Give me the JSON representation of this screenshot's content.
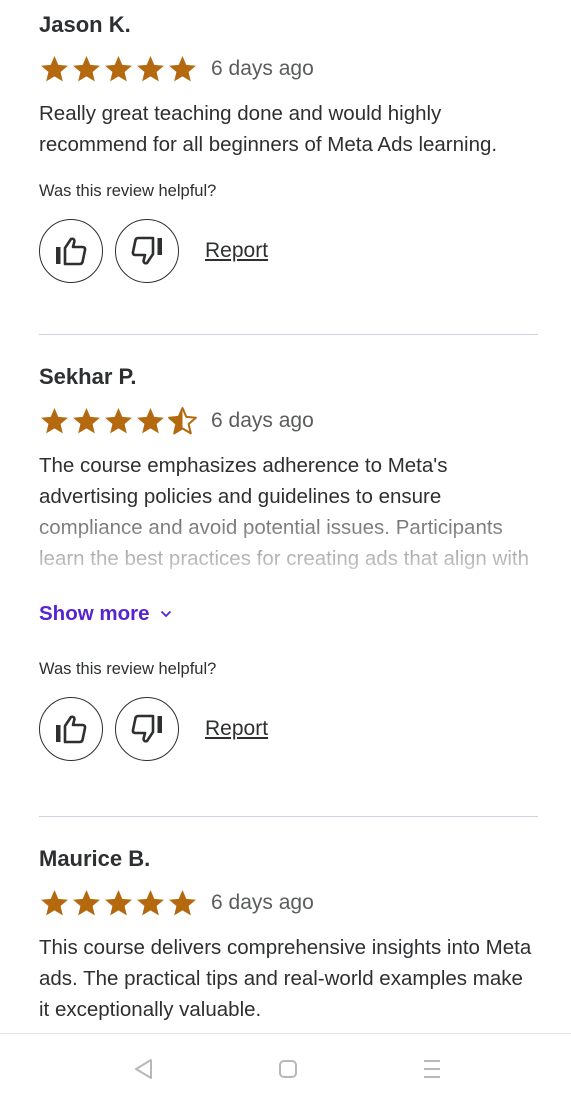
{
  "colors": {
    "star": "#b4690e",
    "link_purple": "#5624d0",
    "text": "#2d2f31",
    "divider": "#d1d2e0"
  },
  "reviews": [
    {
      "name": "Jason K.",
      "rating": 5,
      "date": "6 days ago",
      "text": "Really great teaching done and would highly recommend for all beginners of Meta Ads learning.",
      "helpful_prompt": "Was this review helpful?",
      "report_label": "Report"
    },
    {
      "name": "Sekhar P.",
      "rating": 4.5,
      "date": "6 days ago",
      "text": "The course emphasizes adherence to Meta's advertising policies and guidelines to ensure compliance and avoid potential issues. Participants learn the best practices for creating ads that align with platform requirements and",
      "show_more_label": "Show more",
      "helpful_prompt": "Was this review helpful?",
      "report_label": "Report"
    },
    {
      "name": "Maurice B.",
      "rating": 5,
      "date": "6 days ago",
      "text": "This course delivers comprehensive insights into Meta ads. The practical tips and real-world examples make it exceptionally valuable."
    }
  ],
  "icons": {
    "thumbs_up": "thumbs-up-icon",
    "thumbs_down": "thumbs-down-icon",
    "chevron": "chevron-down-icon",
    "nav_back": "triangle-back-icon",
    "nav_home": "square-home-icon",
    "nav_menu": "menu-lines-icon"
  }
}
